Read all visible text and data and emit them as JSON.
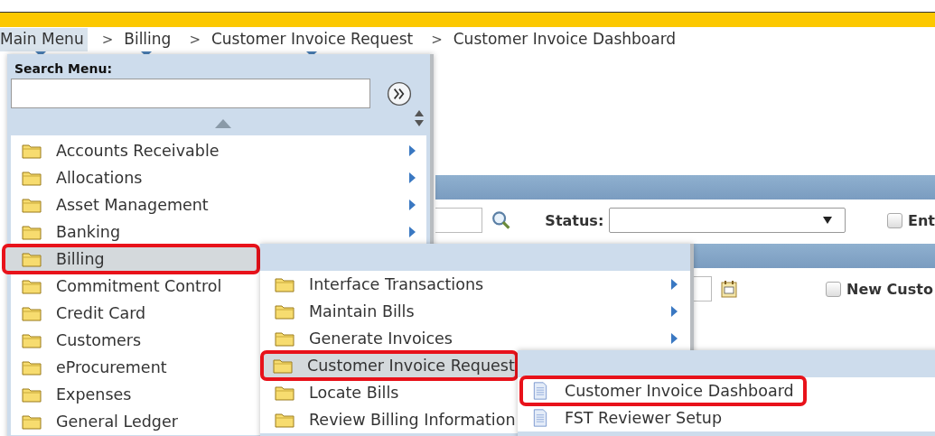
{
  "breadcrumb": [
    {
      "label": "Main Menu",
      "active": true,
      "dropdown": true
    },
    {
      "separator": ">",
      "label": "Billing",
      "active": false,
      "dropdown": true
    },
    {
      "separator": ">",
      "label": "Customer Invoice Request",
      "active": false,
      "dropdown": true
    },
    {
      "separator": ">",
      "label": "Customer Invoice Dashboard",
      "active": false,
      "dropdown": false
    }
  ],
  "page": {
    "status_label": "Status:",
    "checkboxes": [
      {
        "label": "Ent",
        "checked": false
      },
      {
        "label": "New Custo",
        "checked": false
      }
    ]
  },
  "main_menu": {
    "search_label": "Search Menu:",
    "items": [
      {
        "label": "Accounts Receivable",
        "kind": "folder",
        "selected": false,
        "callout": false,
        "arrow": true
      },
      {
        "label": "Allocations",
        "kind": "folder",
        "selected": false,
        "callout": false,
        "arrow": true
      },
      {
        "label": "Asset Management",
        "kind": "folder",
        "selected": false,
        "callout": false,
        "arrow": true
      },
      {
        "label": "Banking",
        "kind": "folder",
        "selected": false,
        "callout": false,
        "arrow": true
      },
      {
        "label": "Billing",
        "kind": "folder",
        "selected": true,
        "callout": true,
        "arrow": false
      },
      {
        "label": "Commitment Control",
        "kind": "folder",
        "selected": false,
        "callout": false,
        "arrow": false
      },
      {
        "label": "Credit Card",
        "kind": "folder",
        "selected": false,
        "callout": false,
        "arrow": false
      },
      {
        "label": "Customers",
        "kind": "folder",
        "selected": false,
        "callout": false,
        "arrow": false
      },
      {
        "label": "eProcurement",
        "kind": "folder",
        "selected": false,
        "callout": false,
        "arrow": false
      },
      {
        "label": "Expenses",
        "kind": "folder",
        "selected": false,
        "callout": false,
        "arrow": false
      },
      {
        "label": "General Ledger",
        "kind": "folder",
        "selected": false,
        "callout": false,
        "arrow": false
      }
    ]
  },
  "billing_menu": {
    "items": [
      {
        "label": "Interface Transactions",
        "kind": "folder",
        "selected": false,
        "callout": false,
        "arrow": true
      },
      {
        "label": "Maintain Bills",
        "kind": "folder",
        "selected": false,
        "callout": false,
        "arrow": true
      },
      {
        "label": "Generate Invoices",
        "kind": "folder",
        "selected": false,
        "callout": false,
        "arrow": true
      },
      {
        "label": "Customer Invoice Request",
        "kind": "folder",
        "selected": true,
        "callout": true,
        "arrow": false
      },
      {
        "label": "Locate Bills",
        "kind": "folder",
        "selected": false,
        "callout": false,
        "arrow": false
      },
      {
        "label": "Review Billing Information",
        "kind": "folder",
        "selected": false,
        "callout": false,
        "arrow": false
      }
    ]
  },
  "request_menu": {
    "items": [
      {
        "label": "Customer Invoice Dashboard",
        "kind": "page",
        "selected": false,
        "callout": true,
        "arrow": false
      },
      {
        "label": "FST Reviewer Setup",
        "kind": "page",
        "selected": false,
        "callout": false,
        "arrow": false
      }
    ]
  }
}
